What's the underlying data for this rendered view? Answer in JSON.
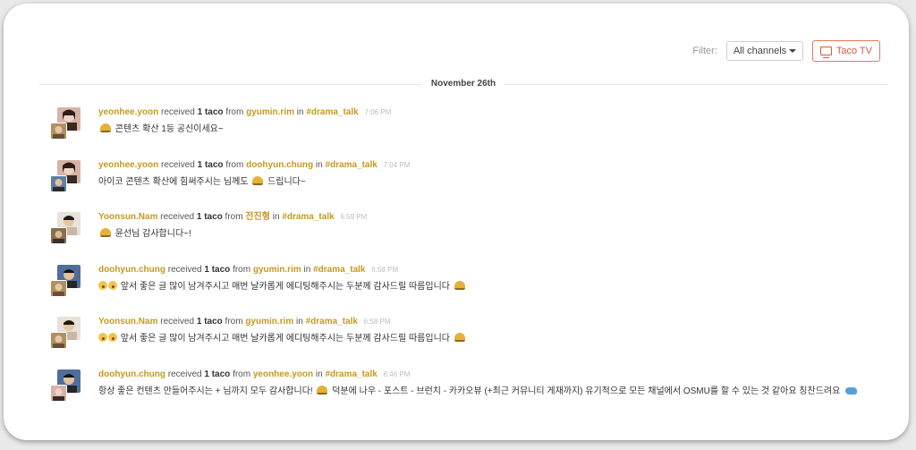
{
  "toolbar": {
    "filter_label": "Filter:",
    "channel_value": "All channels",
    "tacotv_label": "Taco TV"
  },
  "date_divider": "November 26th",
  "feed": [
    {
      "recipient": "yeonhee.yoon",
      "received": "received",
      "amount": "1 taco",
      "from": "from",
      "giver": "gyumin.rim",
      "in": "in",
      "channel": "#drama_talk",
      "time": "7:06 PM",
      "message": "콘텐츠 확산 1등 공신이세요~",
      "recipient_avatar": "#d7b3a7",
      "giver_avatar": "#b08f62"
    },
    {
      "recipient": "yeonhee.yoon",
      "received": "received",
      "amount": "1 taco",
      "from": "from",
      "giver": "doohyun.chung",
      "in": "in",
      "channel": "#drama_talk",
      "time": "7:04 PM",
      "message_pre": "아이코 콘텐츠 확산에 힘써주시는 님께도",
      "message_post": "드립니다~",
      "recipient_avatar": "#d7b3a7",
      "giver_avatar": "#5f7fa6"
    },
    {
      "recipient": "Yoonsun.Nam",
      "received": "received",
      "amount": "1 taco",
      "from": "from",
      "giver": "전진형",
      "in": "in",
      "channel": "#drama_talk",
      "time": "6:59 PM",
      "message": "윤선님 감사합니다~!",
      "recipient_avatar": "#c9b7a5",
      "giver_avatar": "#8a6e50"
    },
    {
      "recipient": "doohyun.chung",
      "received": "received",
      "amount": "1 taco",
      "from": "from",
      "giver": "gyumin.rim",
      "in": "in",
      "channel": "#drama_talk",
      "time": "6:58 PM",
      "message": "앞서 좋은 글 많이 남겨주시고 매번 날카롭게 에디팅해주시는 두분께 감사드릴 따름입니다",
      "recipient_avatar": "#4f6f9a",
      "giver_avatar": "#b08f62"
    },
    {
      "recipient": "Yoonsun.Nam",
      "received": "received",
      "amount": "1 taco",
      "from": "from",
      "giver": "gyumin.rim",
      "in": "in",
      "channel": "#drama_talk",
      "time": "6:58 PM",
      "message": "앞서 좋은 글 많이 남겨주시고 매번 날카롭게 에디팅해주시는 두분께 감사드릴 따름입니다",
      "recipient_avatar": "#c9b7a5",
      "giver_avatar": "#b08f62"
    },
    {
      "recipient": "doohyun.chung",
      "received": "received",
      "amount": "1 taco",
      "from": "from",
      "giver": "yeonhee.yoon",
      "in": "in",
      "channel": "#drama_talk",
      "time": "6:46 PM",
      "message_pre": "항상 좋은 컨텐츠 만들어주시는 + 님까지 모두 감사합니다!",
      "message_post": "덕분에 나우 - 포스트 - 브런치 - 카카오뷰 (+최근 커뮤니티 게재까지) 유기적으로 모든 채널에서 OSMU를 할 수 있는 것 같아요 칭찬드려요",
      "recipient_avatar": "#4f6f9a",
      "giver_avatar": "#d7b3a7"
    }
  ]
}
